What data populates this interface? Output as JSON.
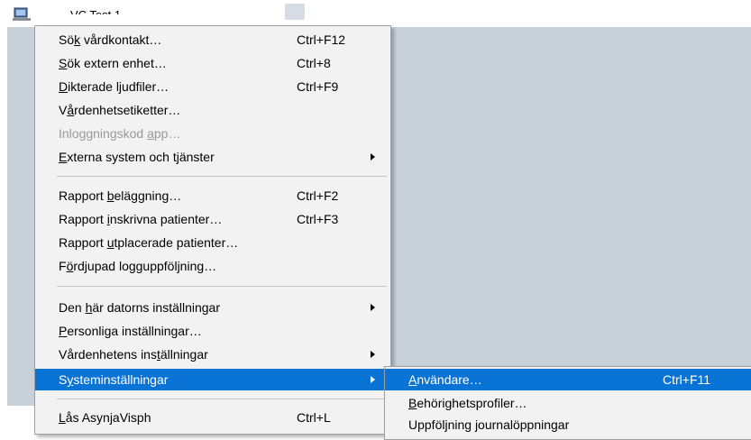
{
  "window": {
    "title": "VC Test 1",
    "icon": "computer-icon"
  },
  "menu": {
    "groups": [
      [
        {
          "pre": "Sö",
          "acc": "k",
          "post": " vårdkontakt…",
          "shortcut": "Ctrl+F12"
        },
        {
          "pre": "",
          "acc": "S",
          "post": "ök extern enhet…",
          "shortcut": "Ctrl+8"
        },
        {
          "pre": "",
          "acc": "D",
          "post": "ikterade ljudfiler…",
          "shortcut": "Ctrl+F9"
        },
        {
          "pre": "V",
          "acc": "å",
          "post": "rdenhetsetiketter…",
          "shortcut": ""
        },
        {
          "pre": "Inloggningskod ",
          "acc": "a",
          "post": "pp…",
          "shortcut": "",
          "disabled": true
        },
        {
          "pre": "",
          "acc": "E",
          "post": "xterna system och tjänster",
          "shortcut": "",
          "submenu": true
        }
      ],
      [
        {
          "pre": "Rapport ",
          "acc": "b",
          "post": "eläggning…",
          "shortcut": "Ctrl+F2"
        },
        {
          "pre": "Rapport ",
          "acc": "i",
          "post": "nskrivna patienter…",
          "shortcut": "Ctrl+F3"
        },
        {
          "pre": "Rapport ",
          "acc": "u",
          "post": "tplacerade patienter…",
          "shortcut": ""
        },
        {
          "pre": "F",
          "acc": "ö",
          "post": "rdjupad logguppföljning…",
          "shortcut": ""
        }
      ],
      [
        {
          "pre": "Den ",
          "acc": "h",
          "post": "är datorns inställningar",
          "shortcut": "",
          "submenu": true
        },
        {
          "pre": "",
          "acc": "P",
          "post": "ersonliga inställningar…",
          "shortcut": ""
        },
        {
          "pre": "Vårdenhetens ins",
          "acc": "t",
          "post": "ällningar",
          "shortcut": "",
          "submenu": true
        },
        {
          "pre": "S",
          "acc": "y",
          "post": "steminställningar",
          "shortcut": "",
          "submenu": true,
          "highlighted": true
        }
      ],
      [
        {
          "pre": "",
          "acc": "L",
          "post": "ås AsynjaVisph",
          "shortcut": "Ctrl+L"
        }
      ]
    ]
  },
  "submenu": {
    "items": [
      {
        "pre": "",
        "acc": "A",
        "post": "nvändare…",
        "shortcut": "Ctrl+F11",
        "highlighted": true
      },
      {
        "pre": "",
        "acc": "B",
        "post": "ehörighetsprofiler…",
        "shortcut": ""
      },
      {
        "pre": "Uppföljning journalöppningar",
        "acc": "",
        "post": "",
        "shortcut": ""
      }
    ]
  },
  "colors": {
    "highlight": "#0a74d6",
    "menu_bg": "#f2f2f2",
    "desktop": "#c8d0da",
    "disabled_text": "#9a9a9a"
  }
}
